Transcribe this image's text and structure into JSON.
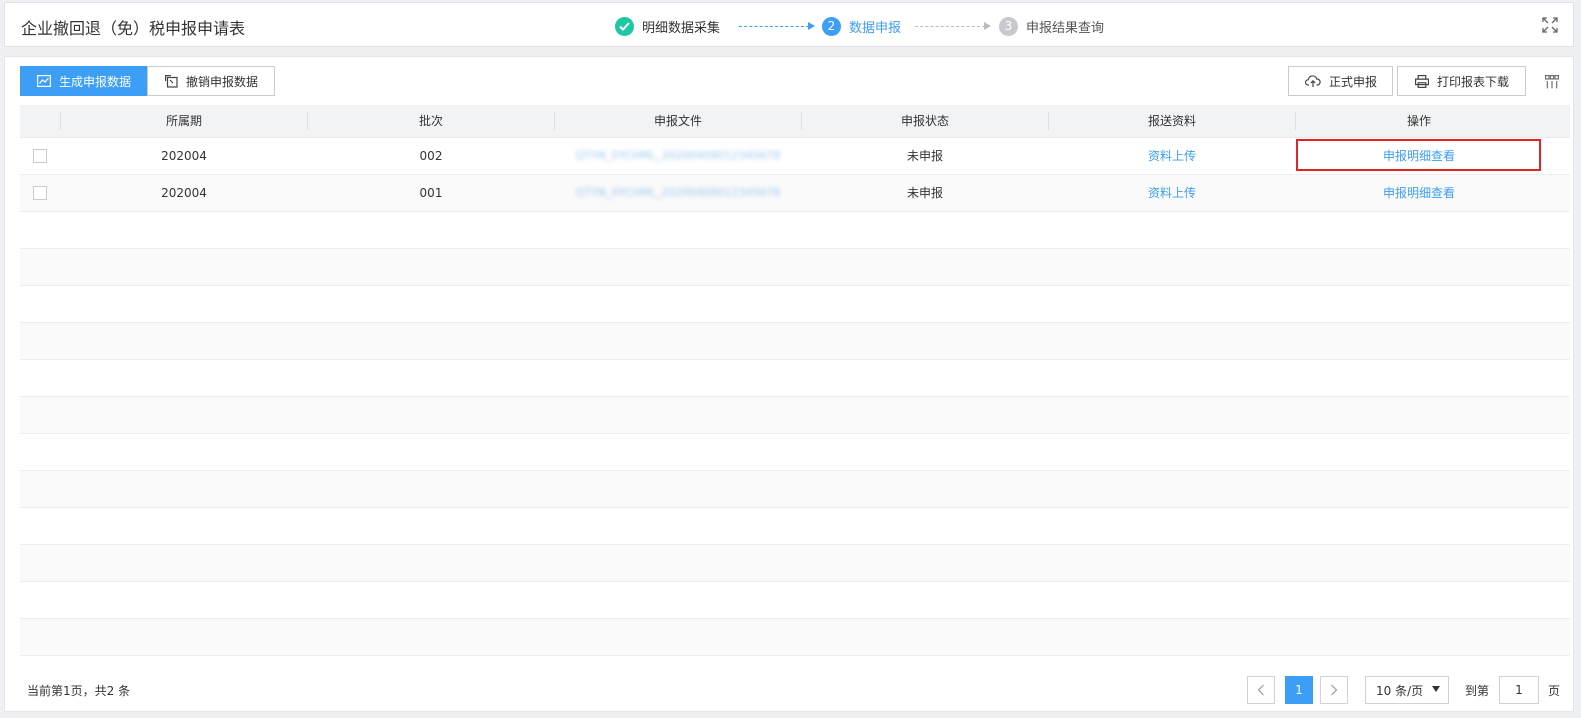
{
  "header": {
    "title": "企业撤回退（免）税申报申请表",
    "steps": [
      {
        "number": "✓",
        "label": "明细数据采集",
        "state": "done"
      },
      {
        "number": "2",
        "label": "数据申报",
        "state": "active"
      },
      {
        "number": "3",
        "label": "申报结果查询",
        "state": "todo"
      }
    ]
  },
  "toolbar": {
    "generate_label": "生成申报数据",
    "revoke_label": "撤销申报数据",
    "submit_label": "正式申报",
    "print_label": "打印报表下载"
  },
  "table": {
    "columns": [
      "所属期",
      "批次",
      "申报文件",
      "申报状态",
      "报送资料",
      "操作"
    ],
    "rows": [
      {
        "period": "202004",
        "batch": "002",
        "file": "QTYN_0YCHML_20200409012345678",
        "status": "未申报",
        "upload": "资料上传",
        "action": "申报明细查看"
      },
      {
        "period": "202004",
        "batch": "001",
        "file": "QTYN_0YCHML_20200409012345678",
        "status": "未申报",
        "upload": "资料上传",
        "action": "申报明细查看"
      }
    ]
  },
  "pagination": {
    "summary": "当前第1页，共2 条",
    "current_page": "1",
    "page_size": "10 条/页",
    "goto_prefix": "到第",
    "goto_value": "1",
    "goto_suffix": "页"
  },
  "colors": {
    "accent": "#3d9ef5",
    "done": "#1ec8a5",
    "highlight": "#e02424"
  }
}
